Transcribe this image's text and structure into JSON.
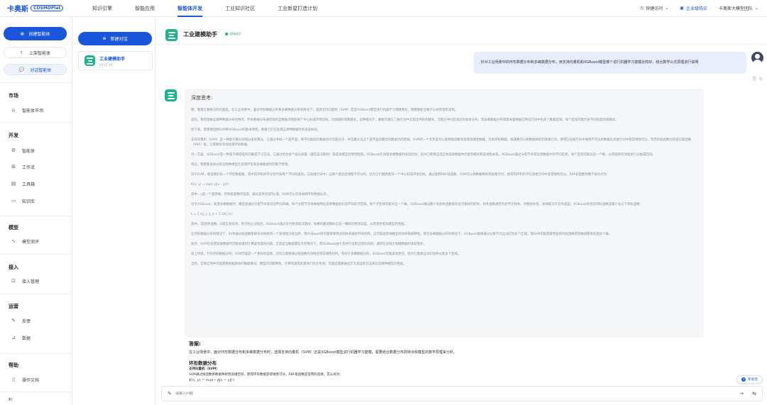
{
  "brand": {
    "name_cn": "卡奥斯",
    "name_en": "COSMOPlat"
  },
  "topnav": [
    {
      "label": "知识引擎",
      "active": false
    },
    {
      "label": "智能应用",
      "active": false
    },
    {
      "label": "智能体开发",
      "active": true
    },
    {
      "label": "工业知识社区",
      "active": false
    },
    {
      "label": "工业新星打造计划",
      "active": false
    }
  ],
  "topright": {
    "quick_access": "快捷访问",
    "enterprise": "企业级购买",
    "team": "卡奥斯大模型团队"
  },
  "sidebar": {
    "create_label": "创建智能体",
    "launched_label": "上架智能体",
    "chat_label": "对话智能体",
    "groups": {
      "market": "市场",
      "dev": "开发",
      "model": "模型",
      "access": "接入",
      "ops": "运营",
      "help": "帮助"
    },
    "items": {
      "agent_market": "智能体市场",
      "agent": "智能体",
      "workflow": "工作流",
      "plugin": "工具箱",
      "knowledge": "知识库",
      "model_eval": "模型测评",
      "access_mgmt": "接入管理",
      "feedback": "反馈",
      "data": "数据",
      "docs": "操作文档"
    }
  },
  "conv_panel": {
    "new_label": "新建对话",
    "card_title": "工业建模助手",
    "card_time": "14:27:15"
  },
  "main": {
    "title": "工业建模助手",
    "status": "连接成功",
    "user_message": "针对工业场景中的环形数据分布和多峰数据分布，用支持向量机和XGBoost模型哪个进行机器学习建模比较好，结合数学公式原理进行说明",
    "think_title": "深度思考:",
    "think_paras": [
      "嗯，我现在要解决的问题是，在工业场景中，面对环形数据分布和多峰数据分布的情况下，选择支持向量机（SVM）还是XGBoost模型进行机器学习建模更好。我需要结合数学公式原理来说明。",
      "首先，我得理解这两种数据分布的特点。环形数据分布通常指的是数据点围绕某个中心形成环状结构，比如圆形或椭圆形。这种情况下，数据可能在二维空间中呈现出环形的模式，可能在中间区域没有样本分布。而多峰数据分布则意味着数据在特征空间中有多个聚集区域，每个区域可能代表不同的类别或模式。",
      "接下来，我需要回顾SVM和XGBoost的基本原理，看看它们在处理这两种数据时的表现如何。",
      "支持向量机（SVM）是一种基于最大间隔分类的算法，它通过寻找一个超平面，将不同类别的数据点尽可能分开，并且最大化这个超平面到最近的数据点的距离。SVM的一个优势是可以使用核函数来处理非线性数据，比如环形数据。核函数可以将数据映射到高维空间，使得在低维空间中线性不可分的数据在高维空间中变得线性可分。常用的核函数包括径向基函数（RBF）核，它能够有效地处理环形数据。",
      "另一方面，XGBoost是一种基于梯度提升的集成学习方法，它通过组合多个弱分类器（通常是决策树）来提高模型的预测性能。XGBoost在处理多峰数据时表现良好，因为它能够自适应地发现数据中的复杂模式和非线性关系。XGBoost通过分裂节点来处理数据中的不同区域，每个区域可能对应一个峰，从而能够有效地进行分类或回归。",
      "现在，我需要具体分析这两种模型在处理环形和多峰数据时的数学原理。",
      "对于SVM，假设我们有一个环形数据集，其中内环和外环分别代表两个不同的类别。在低维空间中，这两个类别是线性不可分的，因为它们围绕着同一个中心形成环状结构。通过使用RBF核函数，SVM可以将数据映射到高维空间，使得内环和外环在高维空间中变得线性可分。RBF核函数的数学表达式为：",
      "K(x, y) = exp(-γ||x - y||²)",
      "其中，γ是一个超参数，控制核函数的宽度。通过选择合适的γ值，SVM可以有效地将环形数据分开。",
      "对于XGBoost，处理多峰数据时，模型会通过分裂节点来识别不同的峰。每个分裂节点会根据特征值将数据划分成不同的子区域，每个子区域可能对应一个峰。XGBoost通过最小化损失函数来优化决策树的结构，损失函数通常包括平方损失、对数损失等，具体取决于任务类型。XGBoost的优化目标函数是最小化以下目标函数：",
      "L = Σ l(y_i, ŷ_i) + Σ Ω(f_m)",
      "其中，l是损失函数，Ω是正则化项，用于防止过拟合。XGBoost通过迭代地添加决策树，每棵树都试图纠正前一棵树的预测误差，从而逐步提高模型的性能。",
      "在环形数据分布的情况下，SVM通过核函数能够有效地找到一个非线性决策边界，而XGBoost则可能需要更多的树来捕捉环形结构，这可能会影响模型的效率和解释性。而在多峰数据分布的情况下，XGBoost能够通过分裂节点自动识别多个区域，而SVM可能需要更复杂的核函数或参数调整来处理多个峰。",
      "此外，SVM在处理高维数据时可能会遇到计算复杂度的问题，尤其是当数据量较大的情况下。而XGBoost由于其并行化和正则化机制，通常在处理大规模数据时表现更好。",
      "综上所述，针对环形数据分布，SVM可能是一个更好的选择，因为它能够通过核函数有效地处理非线性结构。而对于多峰数据分布，XGBoost可能表现更佳，因为它能够自动识别并分类多个区域。",
      "当然，实际应用中可能需要根据具体的数据情况、模型的可解释性、计算资源等因素进行综合考虑，可能还需要通过交叉验证等方法来比较两种模型的性能。"
    ],
    "answer_heading": "答案:",
    "answer_text": "在工业场景中，面对环形数据分布和多峰数据分布时，选择支持向量机（SVM）还是XGBoost模型进行机器学习建模，需要结合数据分布的特点和模型的数学原理来分析。",
    "answer_sub": "环形数据分布",
    "answer_sub2": "支持向量机（SVM）",
    "answer_sub3": "SVM通过核函数将数据映射到高维空间，使得环形数据变得线性可分。RBF核函数是常用的选择，其公式为：",
    "answer_formula": "K(x, y) = exp(−γ‖x − y‖²)",
    "new_conv_float": "新会话",
    "input_placeholder": "请输入问题"
  },
  "colors": {
    "accent": "#1a56db",
    "bot": "#1fb58a",
    "success": "#2ca86d"
  }
}
